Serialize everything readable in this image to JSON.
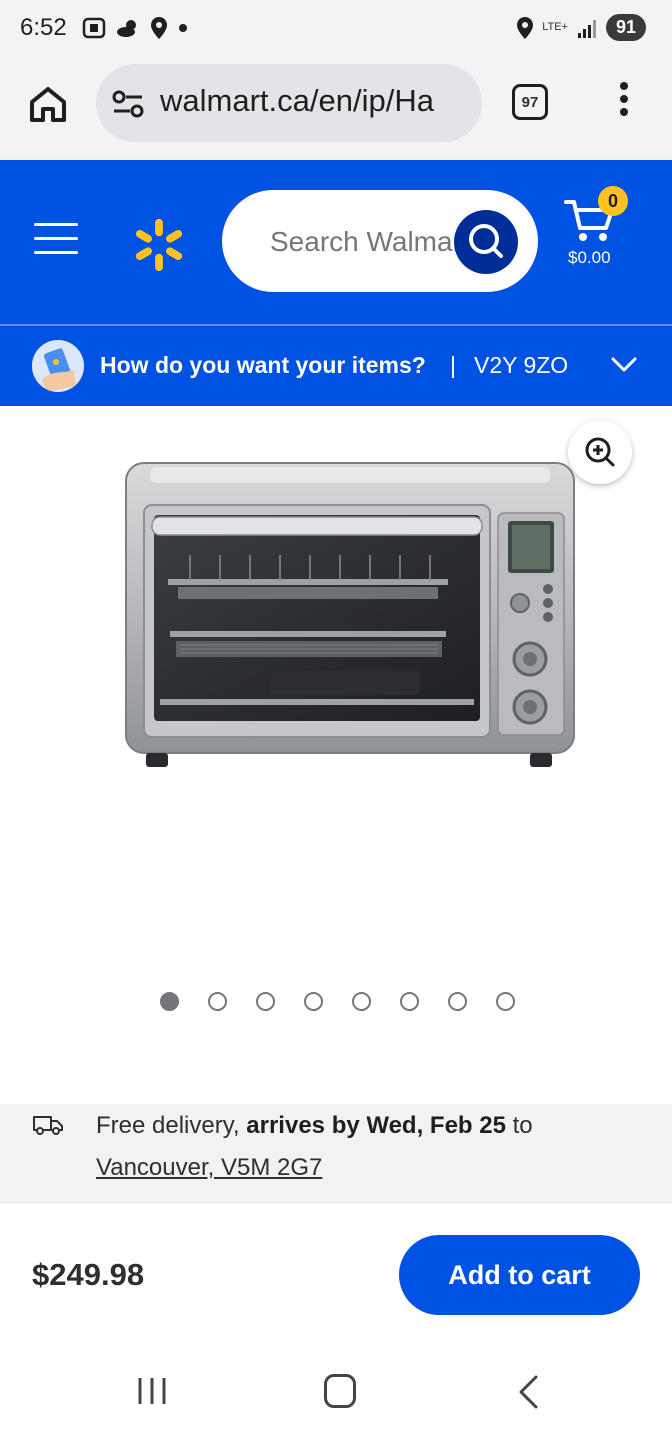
{
  "status_bar": {
    "time": "6:52",
    "network": "LTE+",
    "battery": "91"
  },
  "browser": {
    "url": "walmart.ca/en/ip/Ha",
    "tab_count": "97"
  },
  "header": {
    "search_placeholder": "Search Walmart",
    "cart_count": "0",
    "cart_total": "$0.00",
    "brand_color": "#0053e2",
    "spark_color": "#ffc220"
  },
  "fulfillment": {
    "question": "How do you want your items?",
    "separator": "|",
    "postal_code": "V2Y 9ZO"
  },
  "gallery": {
    "image_count": 8,
    "active_index": 0
  },
  "delivery": {
    "prefix": "Free delivery, ",
    "arrival": "arrives by Wed, Feb 25",
    "suffix": " to",
    "location": "Vancouver, V5M 2G7"
  },
  "purchase": {
    "price": "$249.98",
    "add_to_cart_label": "Add to cart"
  }
}
